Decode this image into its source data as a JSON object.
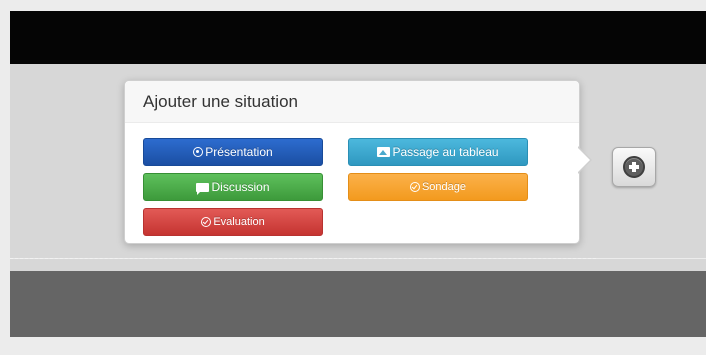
{
  "popover": {
    "title": "Ajouter une situation"
  },
  "buttons": {
    "presentation": {
      "label": "Présentation",
      "icon": "circle-dot-icon",
      "color": "#1f5bb8"
    },
    "passage": {
      "label": "Passage au tableau",
      "icon": "picture-icon",
      "color": "#3aa6cf"
    },
    "discussion": {
      "label": "Discussion",
      "icon": "chat-bubble-icon",
      "color": "#45a843"
    },
    "sondage": {
      "label": "Sondage",
      "icon": "circle-check-icon",
      "color": "#f5a123"
    },
    "evaluation": {
      "label": "Evaluation",
      "icon": "circle-check-icon",
      "color": "#cf3b38"
    }
  },
  "add_button": {
    "icon": "plus-circle-icon"
  }
}
